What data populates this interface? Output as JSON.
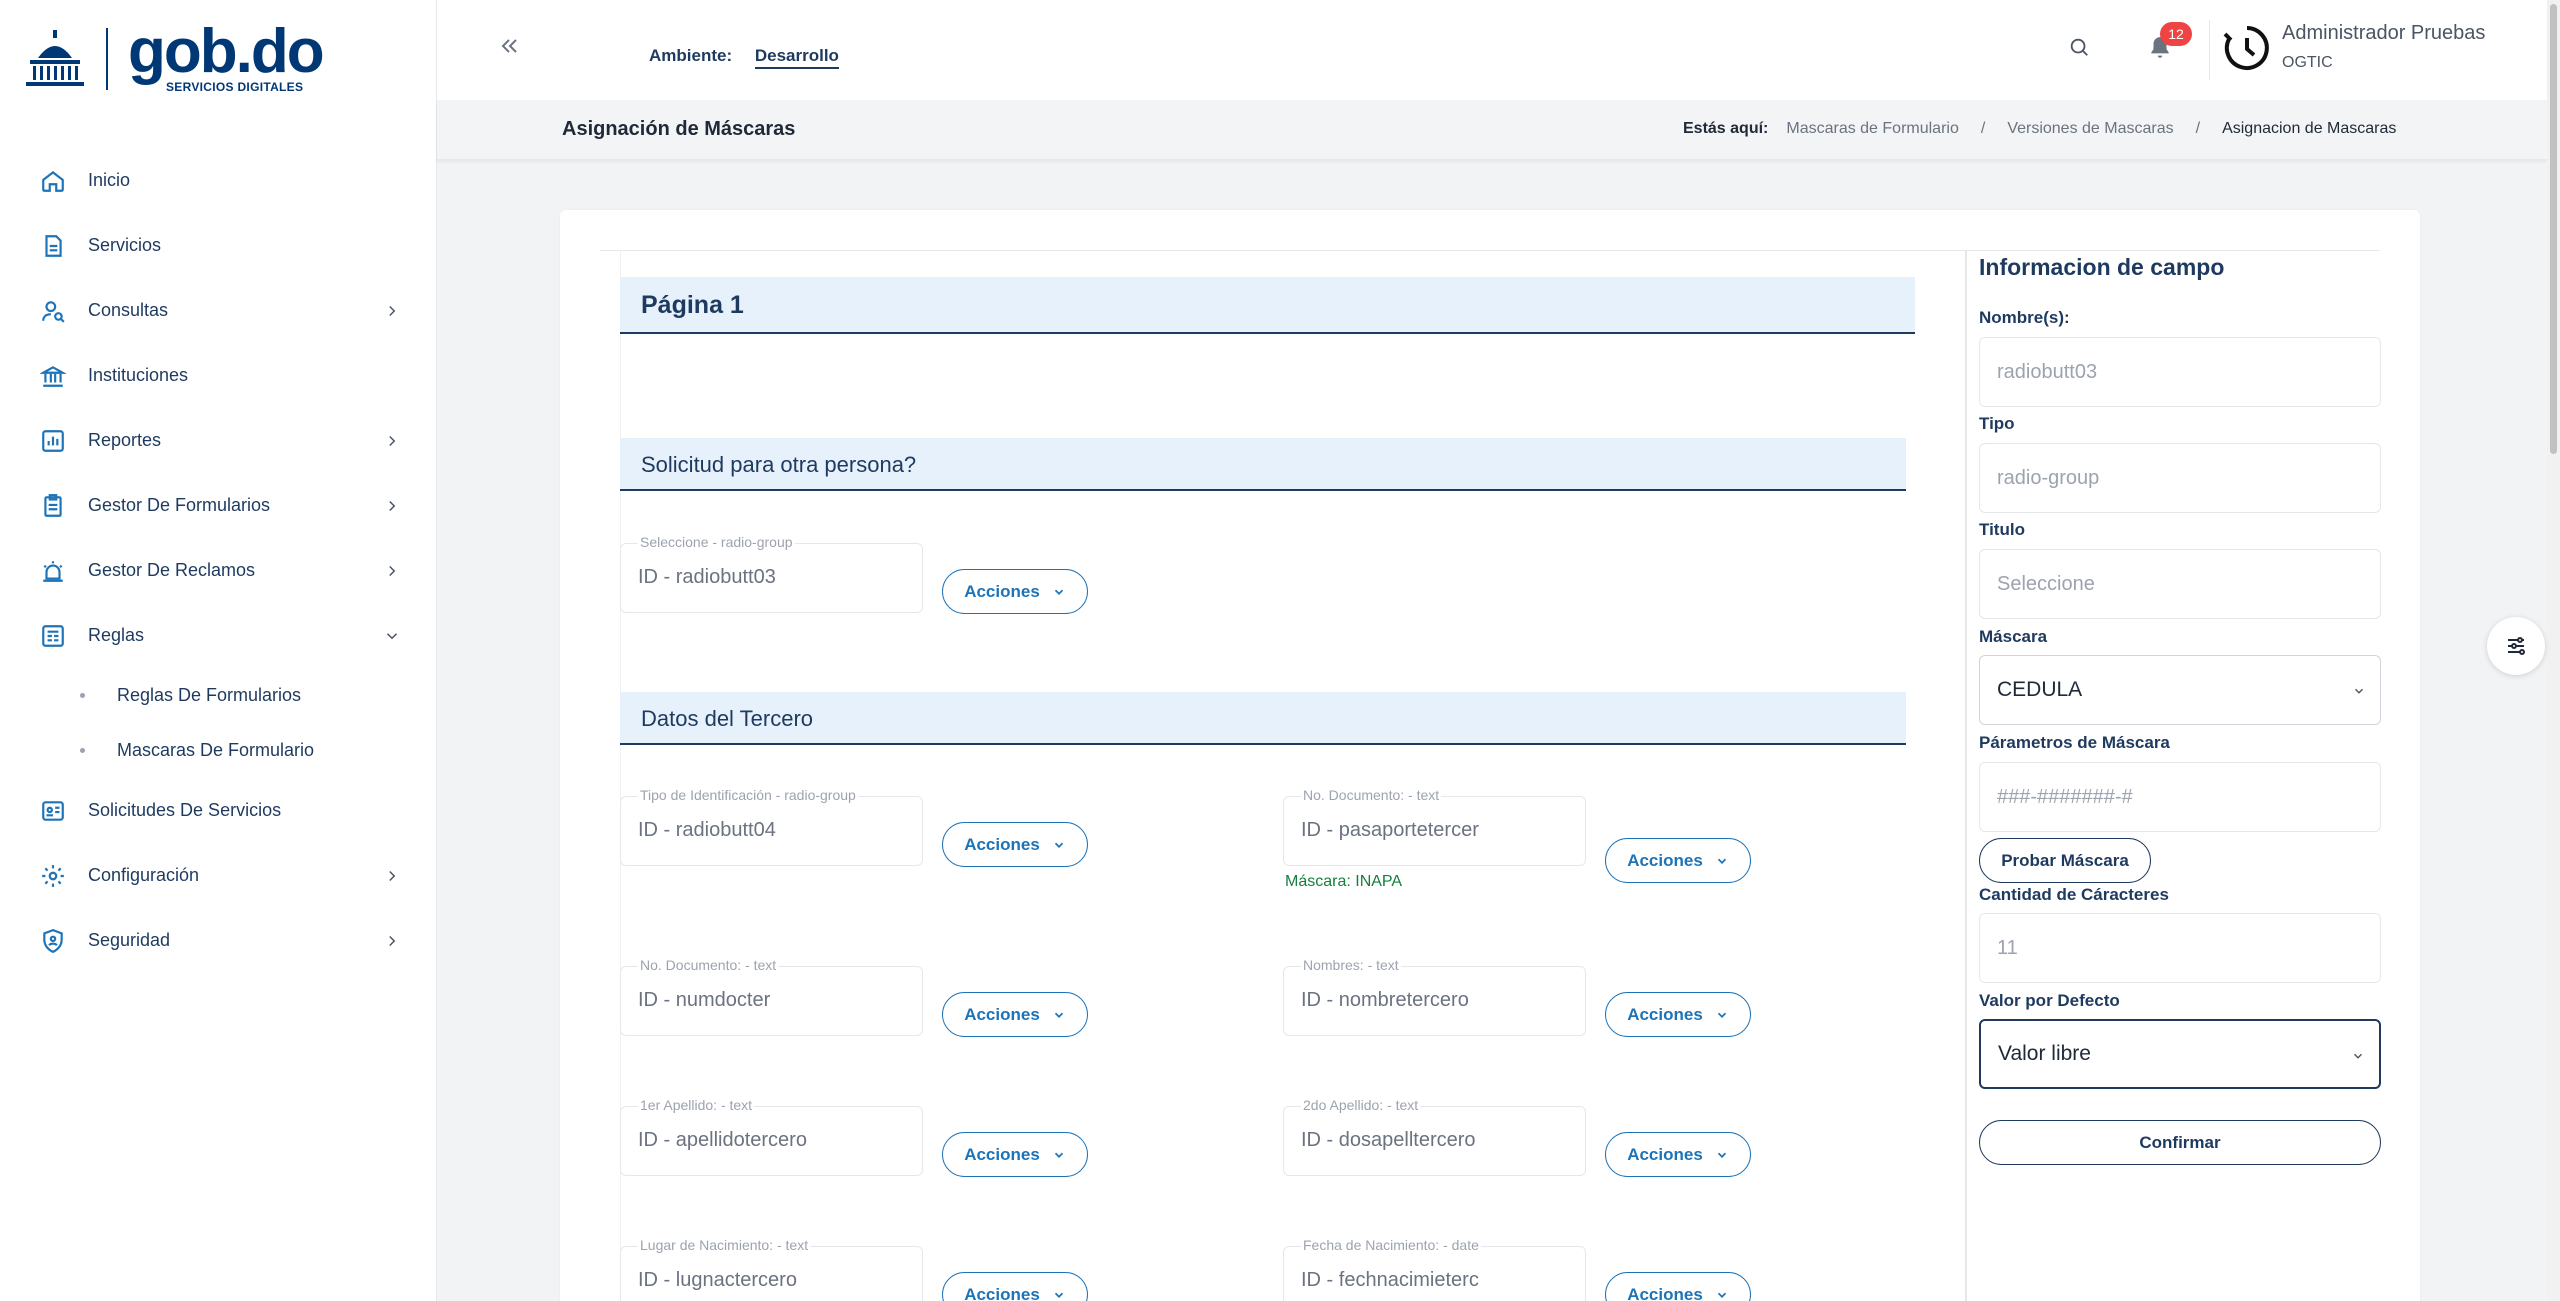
{
  "brand": {
    "name": "gob.do",
    "subtitle": "SERVICIOS DIGITALES"
  },
  "sidebar": {
    "items": [
      {
        "label": "Inicio",
        "icon": "home-icon",
        "has_children": false
      },
      {
        "label": "Servicios",
        "icon": "document-icon",
        "has_children": false
      },
      {
        "label": "Consultas",
        "icon": "user-search-icon",
        "has_children": true
      },
      {
        "label": "Instituciones",
        "icon": "bank-icon",
        "has_children": false
      },
      {
        "label": "Reportes",
        "icon": "chart-icon",
        "has_children": true
      },
      {
        "label": "Gestor De Formularios",
        "icon": "clipboard-icon",
        "has_children": true
      },
      {
        "label": "Gestor De Reclamos",
        "icon": "alarm-icon",
        "has_children": true
      },
      {
        "label": "Reglas",
        "icon": "rules-icon",
        "has_children": true,
        "expanded": true
      },
      {
        "label": "Solicitudes De Servicios",
        "icon": "id-card-icon",
        "has_children": false
      },
      {
        "label": "Configuración",
        "icon": "gear-icon",
        "has_children": true
      },
      {
        "label": "Seguridad",
        "icon": "shield-icon",
        "has_children": true
      }
    ],
    "sub_items": [
      {
        "label": "Reglas De Formularios"
      },
      {
        "label": "Mascaras De Formulario"
      }
    ]
  },
  "header": {
    "env_label": "Ambiente:",
    "env_value": "Desarrollo",
    "notifications": "12",
    "user_name": "Administrador Pruebas",
    "user_org": "OGTIC"
  },
  "subbar": {
    "title": "Asignación de Máscaras",
    "here": "Estás aquí:",
    "crumbs": [
      "Mascaras de Formulario",
      "Versiones de Mascaras",
      "Asignacion de Mascaras"
    ]
  },
  "form": {
    "page_title": "Página 1",
    "actions_label": "Acciones",
    "sections": [
      {
        "title": "Solicitud para otra persona?"
      },
      {
        "title": "Datos del Tercero"
      }
    ],
    "fields": [
      {
        "label": "Seleccione - radio-group",
        "value": "ID - radiobutt03"
      },
      {
        "label": "Tipo de Identificación - radio-group",
        "value": "ID - radiobutt04"
      },
      {
        "label": "No. Documento: - text",
        "value": "ID - pasaportetercer",
        "mask": "Máscara: INAPA"
      },
      {
        "label": "No. Documento: - text",
        "value": "ID - numdocter"
      },
      {
        "label": "Nombres: - text",
        "value": "ID - nombretercero"
      },
      {
        "label": "1er Apellido: - text",
        "value": "ID - apellidotercero"
      },
      {
        "label": "2do Apellido: - text",
        "value": "ID - dosapelltercero"
      },
      {
        "label": "Lugar de Nacimiento: - text",
        "value": "ID - lugnactercero"
      },
      {
        "label": "Fecha de Nacimiento: - date",
        "value": "ID - fechnacimieterc"
      }
    ]
  },
  "panel": {
    "title": "Informacion de campo",
    "nombre_label": "Nombre(s):",
    "nombre_value": "radiobutt03",
    "tipo_label": "Tipo",
    "tipo_value": "radio-group",
    "titulo_label": "Titulo",
    "titulo_value": "Seleccione",
    "mascara_label": "Máscara",
    "mascara_value": "CEDULA",
    "parametros_label": "Párametros de Máscara",
    "parametros_value": "###-#######-#",
    "probar_label": "Probar Máscara",
    "cantidad_label": "Cantidad de Cáracteres",
    "cantidad_value": "11",
    "defecto_label": "Valor por Defecto",
    "defecto_value": "Valor libre",
    "confirm_label": "Confirmar"
  },
  "colors": {
    "primary": "#1e3a5f",
    "accent": "#1d73b8",
    "badge": "#ef4444",
    "mask_note": "#15803d"
  }
}
